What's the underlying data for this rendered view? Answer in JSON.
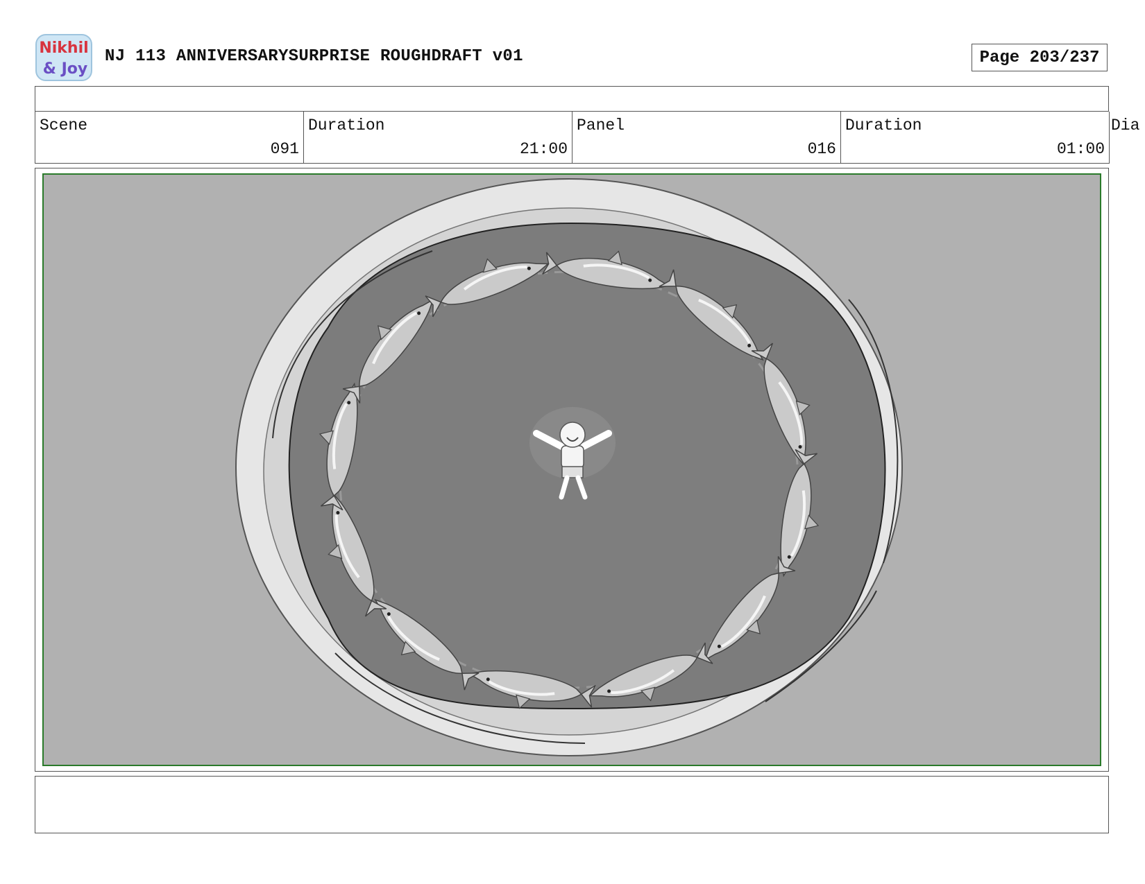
{
  "header": {
    "logo_text_top": "Nikhil",
    "logo_text_bottom": "& Joy",
    "title": "NJ 113 ANNIVERSARYSURPRISE ROUGHDRAFT v01",
    "page_label": "Page 203/237"
  },
  "info": {
    "scene_label": "Scene",
    "scene_value": "091",
    "scene_duration_label": "Duration",
    "scene_duration_value": "21:00",
    "panel_label": "Panel",
    "panel_value": "016",
    "panel_duration_label": "Duration",
    "panel_duration_value": "01:00",
    "dialogue_label": "Dia"
  },
  "panel": {
    "description": "",
    "colors": {
      "background": "#b1b1b1",
      "pool_rim": "#e6e6e6",
      "water": "#7c7c7c",
      "dolphin": "#c9c9c9",
      "frame_border": "#2a7a2a"
    }
  },
  "notes": {
    "text": ""
  }
}
